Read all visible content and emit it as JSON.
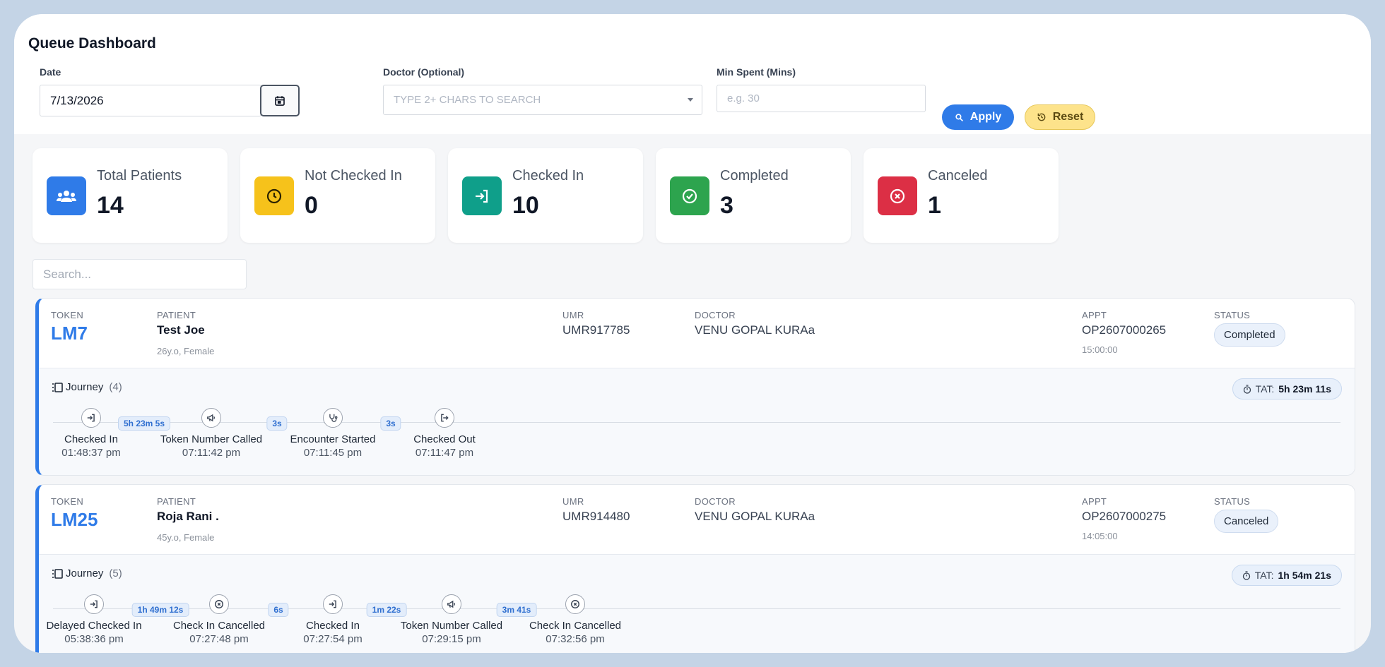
{
  "header": {
    "title": "Queue Dashboard"
  },
  "filters": {
    "date_label": "Date",
    "date_value": "7/13/2026",
    "doctor_label": "Doctor (Optional)",
    "doctor_placeholder": "TYPE 2+ CHARS TO SEARCH",
    "min_label": "Min Spent (Mins)",
    "min_placeholder": "e.g. 30",
    "apply_label": "Apply",
    "reset_label": "Reset"
  },
  "stats": [
    {
      "label": "Total Patients",
      "value": "14",
      "color": "#2f7be8",
      "icon": "users-icon"
    },
    {
      "label": "Not Checked In",
      "value": "0",
      "color": "#f6c21b",
      "icon": "clock-icon"
    },
    {
      "label": "Checked In",
      "value": "10",
      "color": "#0f9f8a",
      "icon": "login-icon"
    },
    {
      "label": "Completed",
      "value": "3",
      "color": "#2da44e",
      "icon": "check-circle-icon"
    },
    {
      "label": "Canceled",
      "value": "1",
      "color": "#dc2f45",
      "icon": "x-circle-icon"
    }
  ],
  "search": {
    "placeholder": "Search..."
  },
  "columns": {
    "token": "TOKEN",
    "patient": "PATIENT",
    "umr": "UMR",
    "doctor": "DOCTOR",
    "appt": "APPT",
    "status": "STATUS"
  },
  "journey_label": "Journey",
  "tat_label": "TAT:",
  "rows": [
    {
      "token": "LM7",
      "patient_name": "Test Joe",
      "patient_meta": "26y.o, Female",
      "umr": "UMR917785",
      "doctor": "VENU GOPAL KURAa",
      "appt_no": "OP2607000265",
      "appt_time": "15:00:00",
      "status": "Completed",
      "journey_count": "(4)",
      "tat": "5h 23m 11s",
      "steps": [
        {
          "name": "Checked In",
          "time": "01:48:37 pm",
          "icon": "login-icon"
        },
        {
          "name": "Token Number Called",
          "time": "07:11:42 pm",
          "icon": "megaphone-icon"
        },
        {
          "name": "Encounter Started",
          "time": "07:11:45 pm",
          "icon": "stethoscope-icon"
        },
        {
          "name": "Checked Out",
          "time": "07:11:47 pm",
          "icon": "logout-icon"
        }
      ],
      "gaps": [
        "5h 23m 5s",
        "3s",
        "3s"
      ]
    },
    {
      "token": "LM25",
      "patient_name": "Roja Rani .",
      "patient_meta": "45y.o, Female",
      "umr": "UMR914480",
      "doctor": "VENU GOPAL KURAa",
      "appt_no": "OP2607000275",
      "appt_time": "14:05:00",
      "status": "Canceled",
      "journey_count": "(5)",
      "tat": "1h 54m 21s",
      "steps": [
        {
          "name": "Delayed Checked In",
          "time": "05:38:36 pm",
          "icon": "login-icon"
        },
        {
          "name": "Check In Cancelled",
          "time": "07:27:48 pm",
          "icon": "x-circle-icon"
        },
        {
          "name": "Checked In",
          "time": "07:27:54 pm",
          "icon": "login-icon"
        },
        {
          "name": "Token Number Called",
          "time": "07:29:15 pm",
          "icon": "megaphone-icon"
        },
        {
          "name": "Check In Cancelled",
          "time": "07:32:56 pm",
          "icon": "x-circle-icon"
        }
      ],
      "gaps": [
        "1h 49m 12s",
        "6s",
        "1m 22s",
        "3m 41s"
      ]
    }
  ]
}
